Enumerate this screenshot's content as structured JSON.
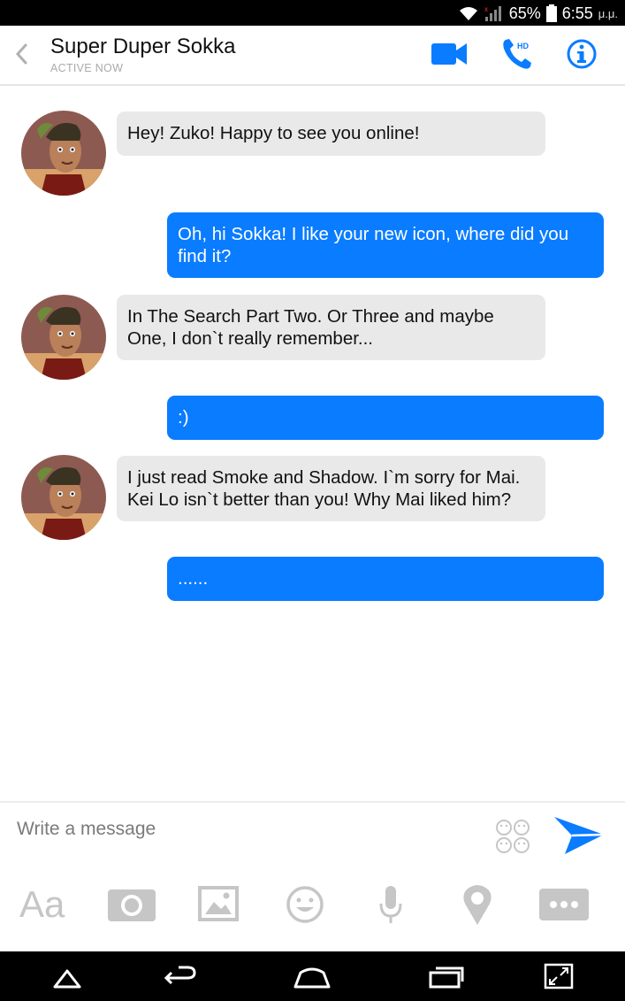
{
  "status_bar": {
    "battery": "65%",
    "time": "6:55",
    "time_suffix": "μ.μ."
  },
  "header": {
    "contact_name": "Super Duper Sokka",
    "status": "ACTIVE NOW",
    "icons": [
      "back-icon",
      "video-call-icon",
      "hd-call-icon",
      "info-icon"
    ]
  },
  "messages": [
    {
      "from": "contact",
      "text": "Hey! Zuko! Happy to see you online!"
    },
    {
      "from": "me",
      "text": "Oh, hi Sokka! I like your new icon, where did you find it?"
    },
    {
      "from": "contact",
      "text": "In The Search Part Two. Or Three and maybe One, I don`t really remember..."
    },
    {
      "from": "me",
      "text": ":)"
    },
    {
      "from": "contact",
      "text": "I just read Smoke and Shadow. I`m sorry for Mai. Kei Lo isn`t better than you! Why Mai liked him?"
    },
    {
      "from": "me",
      "text": "......"
    }
  ],
  "composer": {
    "placeholder": "Write a message",
    "format_label": "Aa",
    "tools": [
      "text-format-icon",
      "camera-icon",
      "gallery-icon",
      "emoji-icon",
      "microphone-icon",
      "location-icon",
      "more-icon"
    ]
  },
  "colors": {
    "accent": "#0a7cff",
    "incoming_bubble": "#e9e9e9",
    "toolbar_icon": "#c6c6c6"
  }
}
